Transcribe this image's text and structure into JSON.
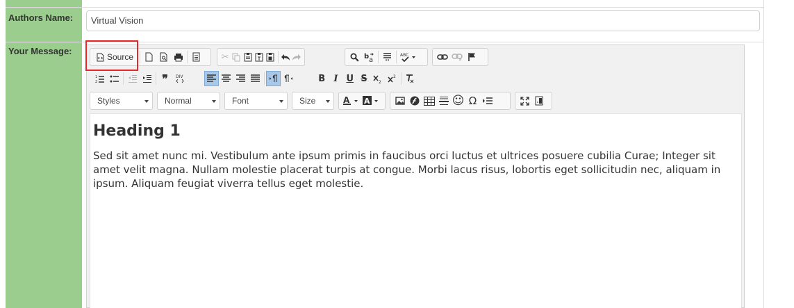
{
  "form": {
    "author_label": "Authors Name:",
    "author_value": "Virtual Vision",
    "message_label": "Your Message:"
  },
  "toolbar": {
    "source_label": "Source",
    "combos": [
      "Styles",
      "Normal",
      "Font",
      "Size"
    ],
    "underline_glyph": "U",
    "bold_glyph": "B",
    "italic_glyph": "I",
    "strike_glyph": "S",
    "omega_glyph": "Ω",
    "smile_glyph": "☺"
  },
  "content": {
    "heading": "Heading 1",
    "paragraph": "Sed sit amet nunc mi. Vestibulum ante ipsum primis in faucibus orci luctus et ultrices posuere cubilia Curae; Integer sit amet velit magna. Nullam molestie placerat turpis at congue. Morbi lacus risus, lobortis eget sollicitudin nec, aliquam in ipsum. Aliquam feugiat viverra tellus eget molestie."
  }
}
